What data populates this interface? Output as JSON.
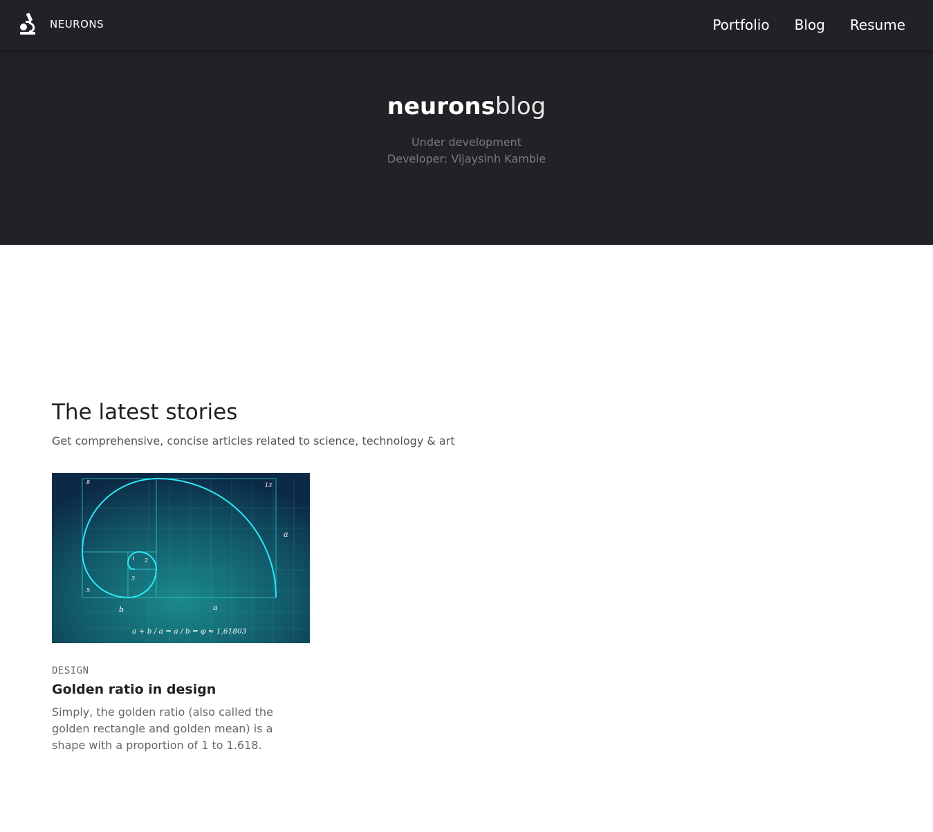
{
  "header": {
    "brand": "NEURONS",
    "logo_icon": "microscope-icon",
    "nav": [
      "Portfolio",
      "Blog",
      "Resume"
    ]
  },
  "hero": {
    "title_bold": "neurons",
    "title_light": "blog",
    "line1": "Under development",
    "line2": "Developer: Vijaysinh Kamble"
  },
  "stories": {
    "title": "The latest stories",
    "subtitle": "Get comprehensive, concise articles related to science, technology & art",
    "cards": [
      {
        "category": "DESIGN",
        "title": "Golden ratio in design",
        "text": "Simply, the golden ratio (also called the golden rectangle and golden mean) is a shape with a proportion of 1 to 1.618.",
        "image": {
          "labels": [
            "8",
            "13",
            "a",
            "1",
            "2",
            "3",
            "5",
            "b",
            "a"
          ],
          "formula": "a + b / a = a / b = φ ≈ 1,61803"
        }
      }
    ]
  },
  "colors": {
    "header_bg": "#212226",
    "accent": "#2ee8f5"
  }
}
